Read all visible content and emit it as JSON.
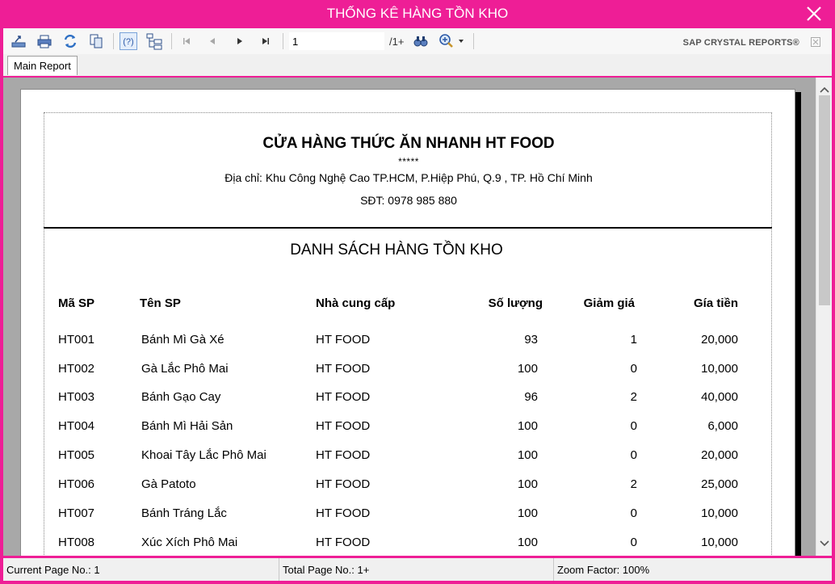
{
  "window": {
    "title": "THỐNG KÊ HÀNG TỒN KHO"
  },
  "toolbar": {
    "page_value": "1",
    "page_total": "/1+",
    "brand": "SAP CRYSTAL REPORTS®"
  },
  "tabs": [
    {
      "label": "Main Report"
    }
  ],
  "report": {
    "store_name": "CỬA HÀNG THỨC ĂN NHANH HT FOOD",
    "stars": "*****",
    "address": "Địa chỉ: Khu Công Nghệ Cao TP.HCM, P.Hiệp Phú, Q.9 , TP. Hồ Chí Minh",
    "phone": "SĐT: 0978 985 880",
    "title": "DANH SÁCH HÀNG TỒN KHO",
    "columns": [
      "Mã SP",
      "Tên SP",
      "Nhà cung cấp",
      "Số lượng",
      "Giảm giá",
      "Gía tiền"
    ],
    "rows": [
      [
        "HT001",
        "Bánh Mì Gà Xé",
        "HT FOOD",
        "93",
        "1",
        "20,000"
      ],
      [
        "HT002",
        "Gà Lắc Phô Mai",
        "HT FOOD",
        "100",
        "0",
        "10,000"
      ],
      [
        "HT003",
        "Bánh Gạo Cay",
        "HT FOOD",
        "96",
        "2",
        "40,000"
      ],
      [
        "HT004",
        "Bánh Mì Hải Sản",
        "HT FOOD",
        "100",
        "0",
        "6,000"
      ],
      [
        "HT005",
        "Khoai Tây Lắc Phô Mai",
        "HT FOOD",
        "100",
        "0",
        "20,000"
      ],
      [
        "HT006",
        "Gà Patoto",
        "HT FOOD",
        "100",
        "2",
        "25,000"
      ],
      [
        "HT007",
        "Bánh Tráng Lắc",
        "HT FOOD",
        "100",
        "0",
        "10,000"
      ],
      [
        "HT008",
        "Xúc Xích Phô Mai",
        "HT FOOD",
        "100",
        "0",
        "10,000"
      ]
    ]
  },
  "status": {
    "current_page": "Current Page No.: 1",
    "total_page": "Total Page No.: 1+",
    "zoom": "Zoom Factor: 100%"
  },
  "colors": {
    "window_frame": "#ee1e96",
    "viewer_bg": "#a8a8a8"
  },
  "icons": [
    "export-icon",
    "print-icon",
    "refresh-icon",
    "copy-icon",
    "help-icon",
    "group-tree-icon",
    "first-page-icon",
    "previous-page-icon",
    "next-page-icon",
    "last-page-icon",
    "find-icon",
    "zoom-icon",
    "close-icon"
  ]
}
